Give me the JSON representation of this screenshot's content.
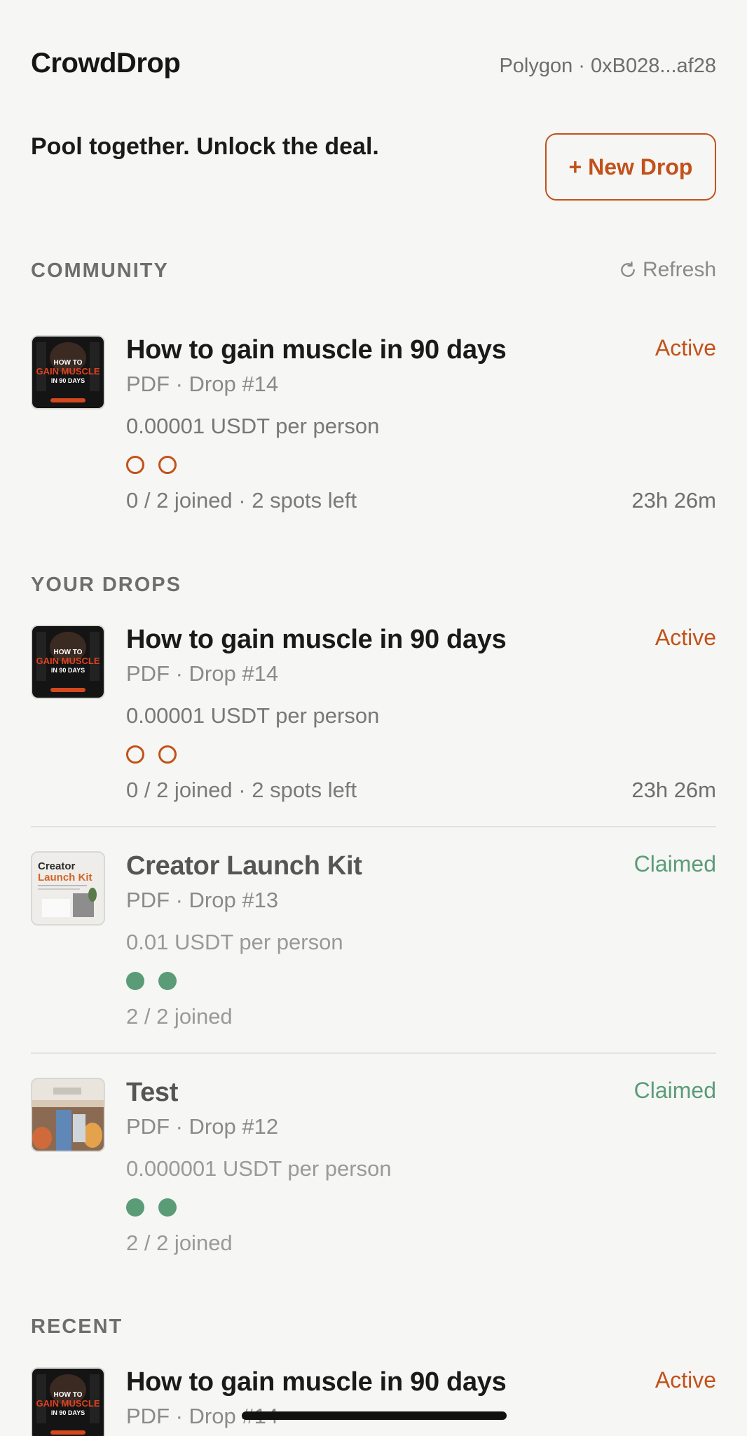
{
  "header": {
    "title": "CrowdDrop",
    "wallet": "Polygon · 0xB028...af28"
  },
  "hero": {
    "tagline": "Pool together. Unlock the deal.",
    "new_drop_label": "+ New Drop"
  },
  "community": {
    "label": "COMMUNITY",
    "refresh_label": "Refresh",
    "items": [
      {
        "title": "How to gain muscle in 90 days",
        "meta": "PDF · Drop #14",
        "price": "0.00001 USDT per person",
        "status": "Active",
        "joined": "0 / 2 joined · 2 spots left",
        "time_left": "23h 26m",
        "thumb_text": [
          "HOW TO",
          "GAIN MUSCLE",
          "IN 90 DAYS"
        ]
      }
    ]
  },
  "your_drops": {
    "label": "YOUR DROPS",
    "items": [
      {
        "title": "How to gain muscle in 90 days",
        "meta": "PDF · Drop #14",
        "price": "0.00001 USDT per person",
        "status": "Active",
        "joined": "0 / 2 joined · 2 spots left",
        "time_left": "23h 26m",
        "thumb_text": [
          "HOW TO",
          "GAIN MUSCLE",
          "IN 90 DAYS"
        ]
      },
      {
        "title": "Creator Launch Kit",
        "meta": "PDF · Drop #13",
        "price": "0.01 USDT per person",
        "status": "Claimed",
        "joined": "2 / 2 joined",
        "thumb_text": [
          "Creator",
          "Launch Kit"
        ]
      },
      {
        "title": "Test",
        "meta": "PDF · Drop #12",
        "price": "0.000001 USDT per person",
        "status": "Claimed",
        "joined": "2 / 2 joined"
      }
    ]
  },
  "recent": {
    "label": "RECENT",
    "items": [
      {
        "title": "How to gain muscle in 90 days",
        "meta": "PDF · Drop #14",
        "status": "Active",
        "thumb_text": [
          "HOW TO",
          "GAIN MUSCLE",
          "IN 90 DAYS"
        ]
      }
    ]
  },
  "colors": {
    "accent": "#c2521a",
    "claimed": "#5a9c78",
    "background": "#f6f6f4"
  }
}
